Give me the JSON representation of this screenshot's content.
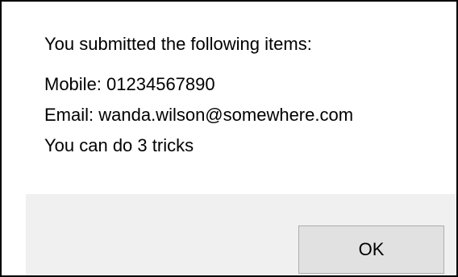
{
  "dialog": {
    "heading": "You submitted the following items:",
    "lines": [
      "Mobile: 01234567890",
      "Email: wanda.wilson@somewhere.com",
      "You can do 3 tricks"
    ],
    "ok_label": "OK"
  },
  "colors": {
    "message_background": "#ffffff",
    "button_area_background": "#f0f0f0",
    "button_background": "#e1e1e1",
    "button_border": "#adadad",
    "dialog_border": "#000000"
  }
}
